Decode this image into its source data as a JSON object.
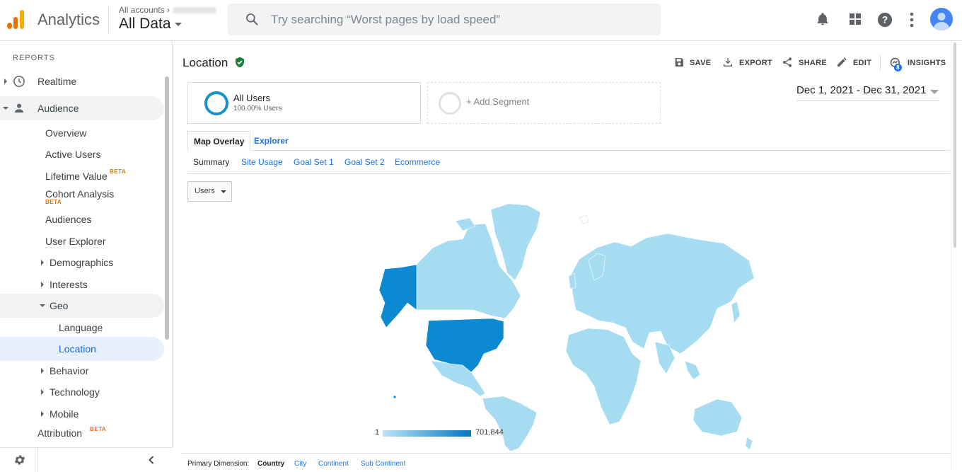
{
  "brand": {
    "product": "Analytics",
    "accent": "#1a73e8",
    "logo_colors": [
      "#f9ab00",
      "#e37400",
      "#e37400"
    ]
  },
  "account": {
    "crumb": "All accounts",
    "view": "All Data"
  },
  "search": {
    "placeholder": "Try searching “Worst pages by load speed”"
  },
  "topbar_icons": [
    "bell-icon",
    "apps-grid-icon",
    "help-icon",
    "more-vert-icon",
    "avatar"
  ],
  "sidebar": {
    "section_label": "REPORTS",
    "realtime": "Realtime",
    "audience": "Audience",
    "overview": "Overview",
    "active_users": "Active Users",
    "lifetime_value": "Lifetime Value",
    "cohort_analysis": "Cohort Analysis",
    "audiences": "Audiences",
    "user_explorer": "User Explorer",
    "demographics": "Demographics",
    "interests": "Interests",
    "geo": "Geo",
    "language": "Language",
    "location": "Location",
    "behavior": "Behavior",
    "technology": "Technology",
    "mobile": "Mobile",
    "attribution": "Attribution",
    "beta": "BETA"
  },
  "page": {
    "title": "Location",
    "actions": {
      "save": "SAVE",
      "export": "EXPORT",
      "share": "SHARE",
      "edit": "EDIT",
      "insights": "INSIGHTS",
      "insights_badge": "8"
    }
  },
  "segments": {
    "current_name": "All Users",
    "current_pct": "100.00% Users",
    "add": "+ Add Segment"
  },
  "date_range": "Dec 1, 2021 - Dec 31, 2021",
  "tabs": {
    "map_overlay": "Map Overlay",
    "explorer": "Explorer"
  },
  "subtabs": {
    "summary": "Summary",
    "site_usage": "Site Usage",
    "goal_set_1": "Goal Set 1",
    "goal_set_2": "Goal Set 2",
    "ecommerce": "Ecommerce"
  },
  "metric_select": "Users",
  "map": {
    "legend_min": "1",
    "legend_max": "701,844",
    "low_color": "#bde4f5",
    "high_color": "#0077c2",
    "highlighted_country": "United States"
  },
  "dimensions": {
    "label": "Primary Dimension:",
    "country": "Country",
    "city": "City",
    "continent": "Continent",
    "sub_continent": "Sub Continent"
  }
}
